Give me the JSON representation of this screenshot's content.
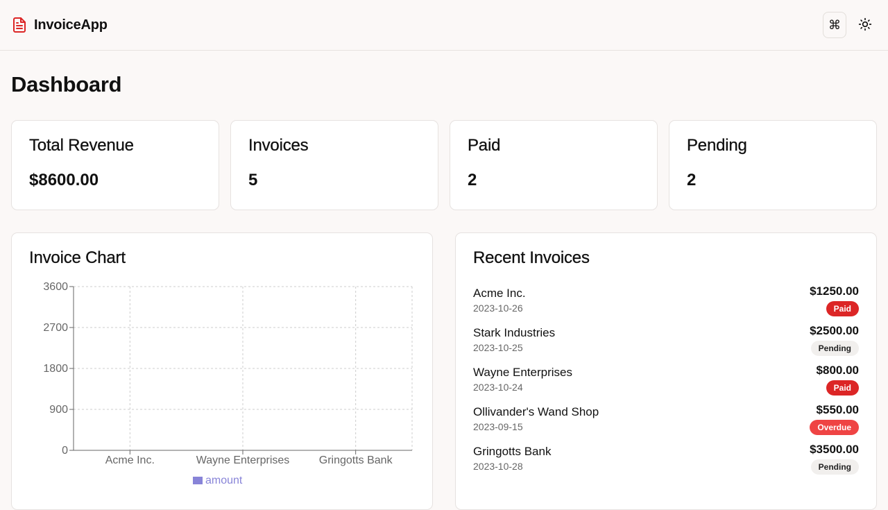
{
  "app": {
    "name": "InvoiceApp"
  },
  "header": {
    "command_label": "⌘"
  },
  "page": {
    "title": "Dashboard"
  },
  "stats": [
    {
      "title": "Total Revenue",
      "value": "$8600.00"
    },
    {
      "title": "Invoices",
      "value": "5"
    },
    {
      "title": "Paid",
      "value": "2"
    },
    {
      "title": "Pending",
      "value": "2"
    }
  ],
  "chart_panel": {
    "title": "Invoice Chart"
  },
  "chart_data": {
    "type": "bar",
    "categories": [
      "Acme Inc.",
      "Wayne Enterprises",
      "Gringotts Bank"
    ],
    "series": [
      {
        "name": "amount",
        "values": [
          0,
          0,
          0
        ]
      }
    ],
    "yticks": [
      "0",
      "900",
      "1800",
      "2700",
      "3600"
    ],
    "ylim": [
      0,
      3600
    ],
    "grid": true,
    "legend": "bottom",
    "colors": {
      "series": "#8884d8",
      "axis": "#666666",
      "grid": "#cccccc"
    }
  },
  "recent": {
    "title": "Recent Invoices",
    "items": [
      {
        "name": "Acme Inc.",
        "date": "2023-10-26",
        "amount": "$1250.00",
        "status": "Paid",
        "kind": "paid"
      },
      {
        "name": "Stark Industries",
        "date": "2023-10-25",
        "amount": "$2500.00",
        "status": "Pending",
        "kind": "pending"
      },
      {
        "name": "Wayne Enterprises",
        "date": "2023-10-24",
        "amount": "$800.00",
        "status": "Paid",
        "kind": "paid"
      },
      {
        "name": "Ollivander's Wand Shop",
        "date": "2023-09-15",
        "amount": "$550.00",
        "status": "Overdue",
        "kind": "overdue"
      },
      {
        "name": "Gringotts Bank",
        "date": "2023-10-28",
        "amount": "$3500.00",
        "status": "Pending",
        "kind": "pending"
      }
    ]
  },
  "colors": {
    "accent": "#dc2626",
    "background": "#fbf8f7"
  }
}
